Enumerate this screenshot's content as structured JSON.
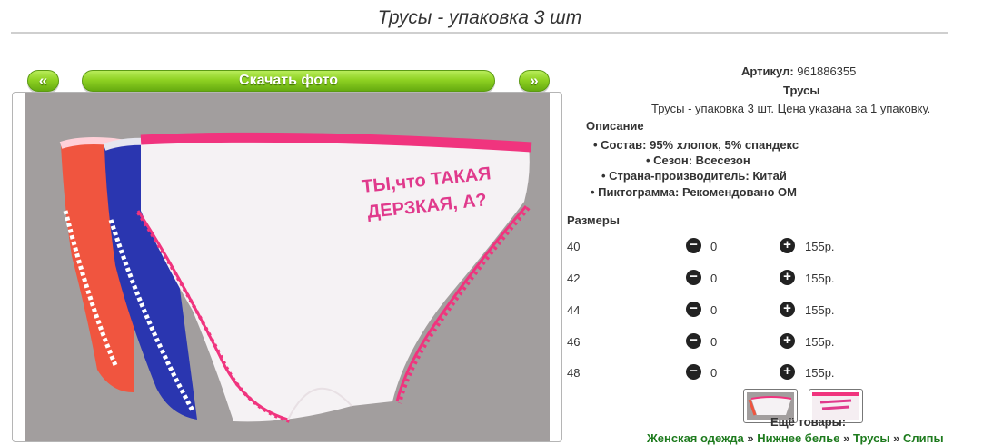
{
  "page": {
    "title": "Трусы - упаковка 3 шт"
  },
  "gallery": {
    "prev_label": "«",
    "download_label": "Скачать фото",
    "next_label": "»",
    "print_text_line1": "ТЫ,что ТАКАЯ",
    "print_text_line2": "ДЕРЗКАЯ, А?"
  },
  "product": {
    "article_label": "Артикул:",
    "article_value": "961886355",
    "name": "Трусы",
    "description": "Трусы - упаковка 3 шт. Цена указана за 1 упаковку.",
    "description_title": "Описание",
    "attributes": [
      "Состав: 95% хлопок, 5% спандекс",
      "Сезон: Всесезон",
      "Страна-производитель: Китай",
      "Пиктограмма: Рекомендовано ОМ"
    ]
  },
  "sizes": {
    "title": "Размеры",
    "rows": [
      {
        "size": "40",
        "qty": "0",
        "price": "155р."
      },
      {
        "size": "42",
        "qty": "0",
        "price": "155р."
      },
      {
        "size": "44",
        "qty": "0",
        "price": "155р."
      },
      {
        "size": "46",
        "qty": "0",
        "price": "155р."
      },
      {
        "size": "48",
        "qty": "0",
        "price": "155р."
      }
    ]
  },
  "more": {
    "title": "Ещё товары:",
    "breadcrumbs": [
      "Женская одежда",
      "Нижнее белье",
      "Трусы",
      "Слипы"
    ],
    "separator": "»"
  },
  "colors": {
    "accent_green": "#8fd223",
    "link_green": "#1e7b1e",
    "photo_bg": "#a29e9e",
    "pink": "#f0347e",
    "blue": "#2a36b0",
    "coral": "#f0553f"
  }
}
